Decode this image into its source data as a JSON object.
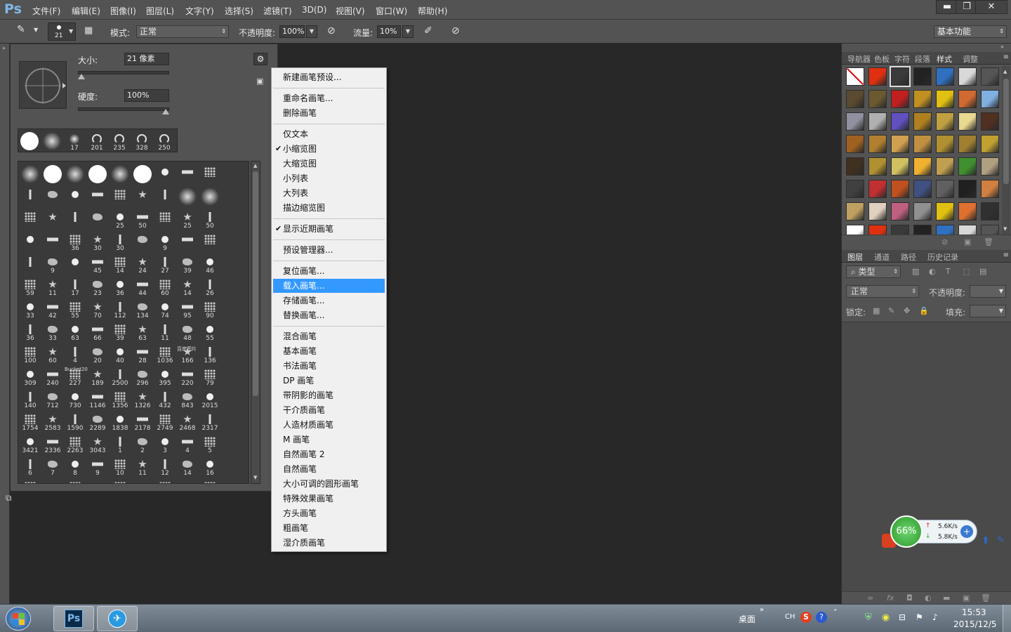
{
  "app": {
    "logo": "Ps"
  },
  "menubar": {
    "items": [
      "文件(F)",
      "编辑(E)",
      "图像(I)",
      "图层(L)",
      "文字(Y)",
      "选择(S)",
      "滤镜(T)",
      "3D(D)",
      "视图(V)",
      "窗口(W)",
      "帮助(H)"
    ],
    "window_buttons": {
      "minimize": "▬",
      "restore": "❐",
      "close": "✕"
    }
  },
  "options": {
    "brush_size_preview": "21",
    "mode_label": "模式:",
    "mode_value": "正常",
    "opacity_label": "不透明度:",
    "opacity_value": "100%",
    "flow_label": "流量:",
    "flow_value": "10%",
    "workspace": "基本功能"
  },
  "brush_picker": {
    "size_label": "大小:",
    "size_value": "21 像素",
    "hardness_label": "硬度:",
    "hardness_value": "100%",
    "size_fraction": 0.04,
    "hardness_fraction": 1.0,
    "recent": [
      {
        "kind": "hard",
        "num": ""
      },
      {
        "kind": "soft",
        "num": ""
      },
      {
        "kind": "soft-small",
        "num": "17"
      },
      {
        "kind": "swirl",
        "num": "201"
      },
      {
        "kind": "swirl",
        "num": "235"
      },
      {
        "kind": "swirl",
        "num": "328"
      },
      {
        "kind": "swirl",
        "num": "250"
      }
    ],
    "grid_labels": [
      "",
      "",
      "",
      "",
      "",
      "",
      "",
      "",
      "",
      "",
      "",
      "",
      "",
      "",
      "",
      "",
      "",
      "",
      "",
      "",
      "",
      "",
      "25",
      "50",
      "",
      "25",
      "50",
      "",
      "",
      "36",
      "30",
      "30",
      "",
      "9",
      "",
      "",
      "",
      "9",
      "",
      "45",
      "14",
      "24",
      "27",
      "39",
      "46",
      "59",
      "11",
      "17",
      "23",
      "36",
      "44",
      "60",
      "14",
      "26",
      "33",
      "42",
      "55",
      "70",
      "112",
      "134",
      "74",
      "95",
      "90",
      "36",
      "33",
      "63",
      "66",
      "39",
      "63",
      "11",
      "48",
      "55",
      "100",
      "60",
      "4",
      "20",
      "40",
      "28",
      "1036",
      "166",
      "136",
      "309",
      "240",
      "227",
      "189",
      "2500",
      "296",
      "395",
      "220",
      "79",
      "140",
      "712",
      "730",
      "1146",
      "1356",
      "1326",
      "432",
      "843",
      "2015",
      "1754",
      "2583",
      "1590",
      "2289",
      "1838",
      "2178",
      "2749",
      "2468",
      "2317",
      "3421",
      "2336",
      "2263",
      "3043",
      "1",
      "2",
      "3",
      "4",
      "5",
      "6",
      "7",
      "8",
      "9",
      "10",
      "11",
      "12",
      "14",
      "16"
    ],
    "grid_text_samples": {
      "sample_a": "Bucket20",
      "sample_b": "百度图片"
    }
  },
  "context_menu": {
    "items": [
      {
        "label": "新建画笔预设...",
        "checked": false,
        "highlight": false
      },
      {
        "sep": true
      },
      {
        "label": "重命名画笔...",
        "checked": false,
        "highlight": false
      },
      {
        "label": "删除画笔",
        "checked": false,
        "highlight": false
      },
      {
        "sep": true
      },
      {
        "label": "仅文本",
        "checked": false,
        "highlight": false
      },
      {
        "label": "小缩览图",
        "checked": true,
        "highlight": false
      },
      {
        "label": "大缩览图",
        "checked": false,
        "highlight": false
      },
      {
        "label": "小列表",
        "checked": false,
        "highlight": false
      },
      {
        "label": "大列表",
        "checked": false,
        "highlight": false
      },
      {
        "label": "描边缩览图",
        "checked": false,
        "highlight": false
      },
      {
        "sep": true
      },
      {
        "label": "显示近期画笔",
        "checked": true,
        "highlight": false
      },
      {
        "sep": true
      },
      {
        "label": "预设管理器...",
        "checked": false,
        "highlight": false
      },
      {
        "sep": true
      },
      {
        "label": "复位画笔...",
        "checked": false,
        "highlight": false
      },
      {
        "label": "载入画笔...",
        "checked": false,
        "highlight": true
      },
      {
        "label": "存储画笔...",
        "checked": false,
        "highlight": false
      },
      {
        "label": "替换画笔...",
        "checked": false,
        "highlight": false
      },
      {
        "sep": true
      },
      {
        "label": "混合画笔",
        "checked": false,
        "highlight": false
      },
      {
        "label": "基本画笔",
        "checked": false,
        "highlight": false
      },
      {
        "label": "书法画笔",
        "checked": false,
        "highlight": false
      },
      {
        "label": "DP 画笔",
        "checked": false,
        "highlight": false
      },
      {
        "label": "带阴影的画笔",
        "checked": false,
        "highlight": false
      },
      {
        "label": "干介质画笔",
        "checked": false,
        "highlight": false
      },
      {
        "label": "人造材质画笔",
        "checked": false,
        "highlight": false
      },
      {
        "label": "M 画笔",
        "checked": false,
        "highlight": false
      },
      {
        "label": "自然画笔 2",
        "checked": false,
        "highlight": false
      },
      {
        "label": "自然画笔",
        "checked": false,
        "highlight": false
      },
      {
        "label": "大小可调的圆形画笔",
        "checked": false,
        "highlight": false
      },
      {
        "label": "特殊效果画笔",
        "checked": false,
        "highlight": false
      },
      {
        "label": "方头画笔",
        "checked": false,
        "highlight": false
      },
      {
        "label": "粗画笔",
        "checked": false,
        "highlight": false
      },
      {
        "label": "湿介质画笔",
        "checked": false,
        "highlight": false
      }
    ]
  },
  "styles_panel": {
    "tabs": [
      "导航器",
      "色板",
      "字符",
      "段落",
      "样式",
      "调整"
    ],
    "active_tab": "样式",
    "swatch_colors": [
      "#ffffff",
      "#e03010",
      "#3a3a3a",
      "#222222",
      "#3070c0",
      "#d8d8d8",
      "#555555",
      "#5a4a30",
      "#6a5a30",
      "#c02020",
      "#c09020",
      "#e0c010",
      "#d06a30",
      "#80b0e0",
      "#9090a0",
      "#b0b0b0",
      "#6050c0",
      "#b08020",
      "#c0a040",
      "#e8d890",
      "#503020",
      "#a06020",
      "#b08030",
      "#d0a050",
      "#c09040",
      "#b09030",
      "#a08030",
      "#c0a030",
      "#403020",
      "#b09030",
      "#d0c060",
      "#f0b030",
      "#c0a050",
      "#409030",
      "#b0a080",
      "#404040",
      "#c03030",
      "#c05020",
      "#405080",
      "#606060",
      "#202020",
      "#d08040",
      "#c0a060",
      "#e0d0c0",
      "#c06080",
      "#909090",
      "#e0c010",
      "#e07030",
      "#303030"
    ]
  },
  "layers_panel": {
    "tabs": [
      "图层",
      "通道",
      "路径",
      "历史记录"
    ],
    "active_tab": "图层",
    "kind_filter": "类型",
    "blend_mode": "正常",
    "opacity_label": "不透明度:",
    "lock_label": "锁定:",
    "fill_label": "填充:"
  },
  "net_widget": {
    "percent": "66%",
    "up_speed": "5.6K/s",
    "down_speed": "5.8K/s"
  },
  "taskbar": {
    "ps_label": "Ps",
    "desktop_label": "桌面",
    "ime_label": "CH",
    "time": "15:53",
    "date": "2015/12/5",
    "expand": "»"
  },
  "colors": {
    "ui_bg": "#535353",
    "canvas_bg": "#282828",
    "menu_highlight": "#3399ff",
    "ps_blue": "#7fb8e8"
  }
}
